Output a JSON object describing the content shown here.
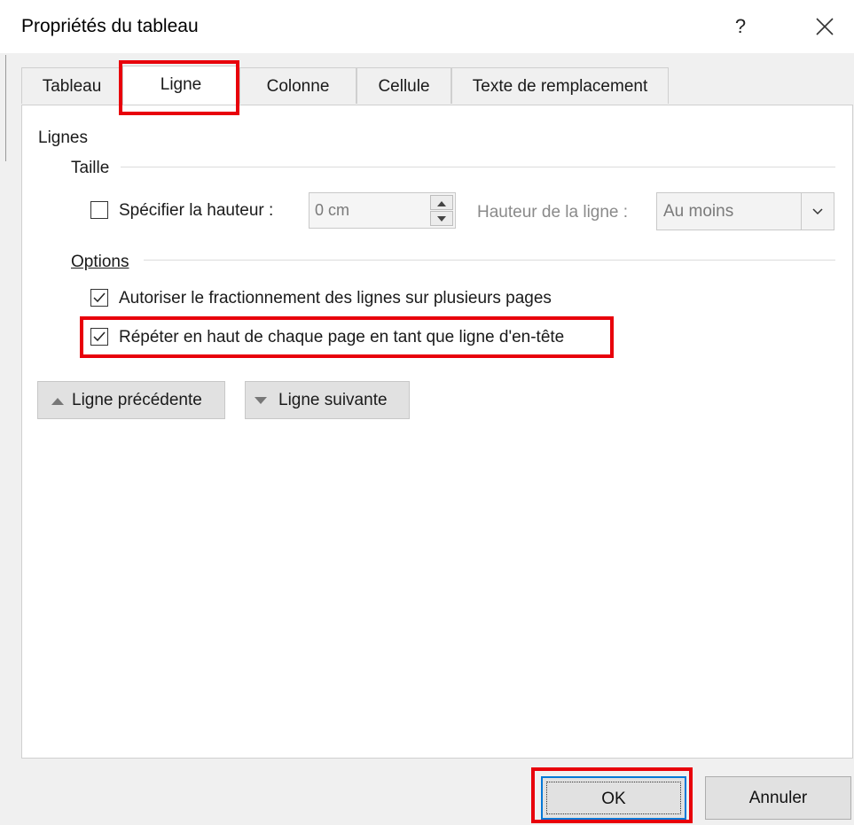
{
  "dialog": {
    "title": "Propriétés du tableau",
    "help": "?"
  },
  "tabs": [
    {
      "label": "Tableau",
      "active": false
    },
    {
      "label": "Ligne",
      "active": true
    },
    {
      "label": "Colonne",
      "active": false
    },
    {
      "label": "Cellule",
      "active": false
    },
    {
      "label": "Texte de remplacement",
      "active": false
    }
  ],
  "lignes": {
    "section_label": "Lignes",
    "taille_label": "Taille",
    "specify_height": {
      "label": "Spécifier la hauteur :",
      "checked": false
    },
    "height_value": "0 cm",
    "row_height_label": "Hauteur de la ligne :",
    "row_height_value": "Au moins",
    "options_label": "Options",
    "allow_break": {
      "label": "Autoriser le fractionnement des lignes sur plusieurs pages",
      "checked": true
    },
    "repeat_header": {
      "label": "Répéter en haut de chaque page en tant que ligne d'en-tête",
      "checked": true
    }
  },
  "nav": {
    "previous": "Ligne précédente",
    "next": "Ligne suivante"
  },
  "footer": {
    "ok": "OK",
    "cancel": "Annuler"
  },
  "colors": {
    "highlight": "#e8000b",
    "focus": "#0078d7"
  }
}
